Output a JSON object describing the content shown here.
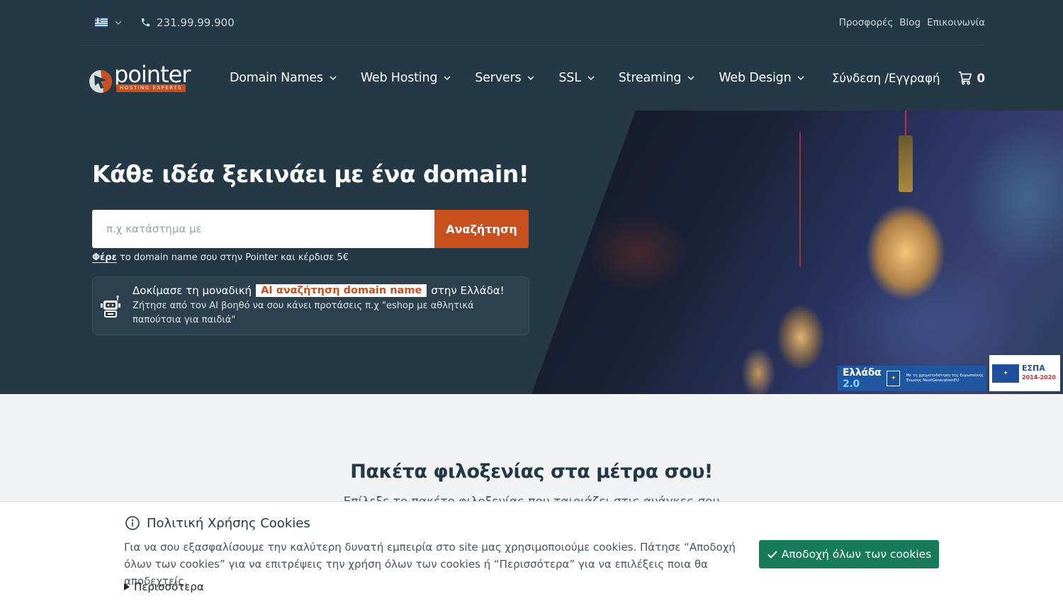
{
  "topbar": {
    "language": "el",
    "language_flag_icon": "greek-flag-icon",
    "phone": "231.99.99.900",
    "links": [
      "Προσφορές",
      "Blog",
      "Επικοινωνία"
    ]
  },
  "brand": {
    "name": "pointer",
    "tagline": "HOSTING EXPERTS",
    "accent": "#c8501e"
  },
  "nav": {
    "items": [
      {
        "label": "Domain Names"
      },
      {
        "label": "Web Hosting"
      },
      {
        "label": "Servers"
      },
      {
        "label": "SSL"
      },
      {
        "label": "Streaming"
      },
      {
        "label": "Web Design"
      }
    ],
    "login_label": "Σύνδεση /Εγγραφή",
    "cart_count": "0"
  },
  "hero": {
    "title": "Κάθε ιδέα ξεκινάει με ένα domain!",
    "search_placeholder": "π.χ κατάστημα με",
    "search_value": "",
    "search_button": "Αναζήτηση",
    "transfer_link": "Φέρε",
    "transfer_text": " το domain name σου στην Pointer και κέρδισε 5€",
    "ai": {
      "prefix": "Δοκίμασε τη μοναδική",
      "badge": "AI αναζήτηση domain name",
      "suffix": "στην Ελλάδα!",
      "description": "Ζήτησε από τον AI βοηθό να σου κάνει προτάσεις π.χ \"eshop με αθλητικά παπούτσια για παιδιά\""
    }
  },
  "funding": {
    "greece20_title": "Ελλάδα",
    "greece20_number": "2.0",
    "greece20_text": "Με τη χρηματοδότηση της Ευρωπαϊκής Ένωσης NextGenerationEU",
    "espa_title": "ΕΣΠΑ",
    "espa_years": "2014-2020"
  },
  "section": {
    "title": "Πακέτα φιλοξενίας στα μέτρα σου!",
    "subtitle": "Επίλεξε το πακέτο φιλοξενίας που ταιριάζει στις ανάγκες σου"
  },
  "cookie": {
    "title": "Πολιτική Χρήσης Cookies",
    "text": "Για να σου εξασφαλίσουμε την καλύτερη δυνατή εμπειρία στο site μας χρησιμοποιούμε cookies. Πάτησε “Αποδοχή όλων των cookies” για να επιτρέψεις την χρήση όλων των cookies ή “Περισσότερα” για να επιλέξεις ποια θα αποδεχτείς.",
    "more_label": "Περισσότερα",
    "accept_label": "Αποδοχή όλων των cookies",
    "accept_color": "#177a58"
  }
}
